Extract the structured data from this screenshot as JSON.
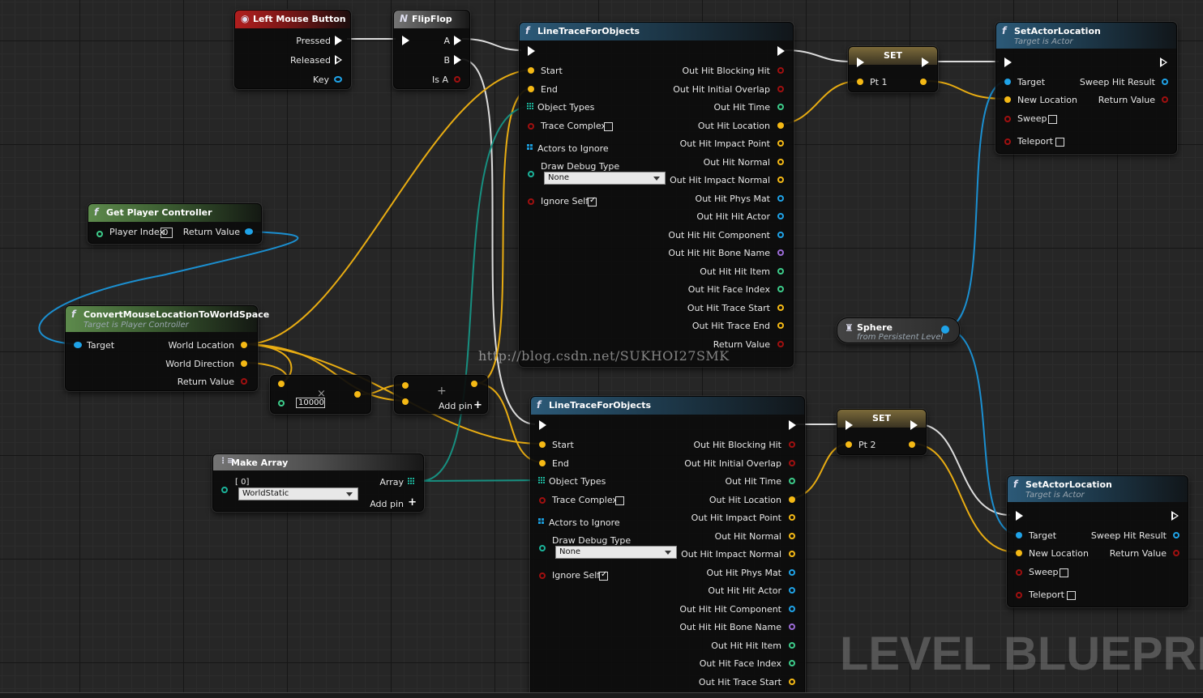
{
  "watermark": "http://blog.csdn.net/SUKHOI27SMK",
  "level_blueprint": "LEVEL BLUEPRINT",
  "nodes": {
    "lmb": {
      "title": "Left Mouse Button",
      "pressed": "Pressed",
      "released": "Released",
      "key": "Key"
    },
    "flipflop": {
      "title": "FlipFlop",
      "a": "A",
      "b": "B",
      "is_a": "Is A"
    },
    "get_pc": {
      "title": "Get Player Controller",
      "player_index": "Player Index",
      "player_index_value": "0",
      "return_value": "Return Value"
    },
    "convert": {
      "title": "ConvertMouseLocationToWorldSpace",
      "subtitle": "Target is Player Controller",
      "target": "Target",
      "world_location": "World Location",
      "world_direction": "World Direction",
      "return_value": "Return Value"
    },
    "multiply": {
      "symbol": "×",
      "value": "10000"
    },
    "add": {
      "symbol": "+",
      "add_pin": "Add pin"
    },
    "make_array": {
      "title": "Make Array",
      "index": "[ 0]",
      "selected": "WorldStatic",
      "array": "Array",
      "add_pin": "Add pin"
    },
    "trace": {
      "title": "LineTraceForObjects",
      "inputs": {
        "start": "Start",
        "end": "End",
        "object_types": "Object Types",
        "trace_complex": "Trace Complex",
        "actors_to_ignore": "Actors to Ignore",
        "draw_debug_type": "Draw Debug Type",
        "draw_debug_value": "None",
        "ignore_self": "Ignore Self"
      },
      "outputs": [
        "Out Hit Blocking Hit",
        "Out Hit Initial Overlap",
        "Out Hit Time",
        "Out Hit Location",
        "Out Hit Impact Point",
        "Out Hit Normal",
        "Out Hit Impact Normal",
        "Out Hit Phys Mat",
        "Out Hit Hit Actor",
        "Out Hit Hit Component",
        "Out Hit Hit Bone Name",
        "Out Hit Hit Item",
        "Out Hit Face Index",
        "Out Hit Trace Start",
        "Out Hit Trace End",
        "Return Value"
      ]
    },
    "set1": {
      "title": "SET",
      "var": "Pt 1"
    },
    "set2": {
      "title": "SET",
      "var": "Pt 2"
    },
    "set_actor": {
      "title": "SetActorLocation",
      "subtitle": "Target is Actor",
      "target": "Target",
      "new_location": "New Location",
      "sweep": "Sweep",
      "teleport": "Teleport",
      "sweep_hit_result": "Sweep Hit Result",
      "return_value": "Return Value"
    },
    "sphere": {
      "title": "Sphere",
      "subtitle": "from Persistent Level"
    }
  },
  "colors": {
    "exec": "#ffffff",
    "vector": "#f5b915",
    "object": "#1fa3e8",
    "bool": "#a01010",
    "float": "#3dcc8a",
    "struct": "#1bb39a",
    "name": "#9b6bd6"
  },
  "icons": {
    "event": "mouse-icon",
    "function": "function-icon",
    "macro": "macro-icon",
    "array": "array-icon",
    "variable": "variable-icon"
  }
}
